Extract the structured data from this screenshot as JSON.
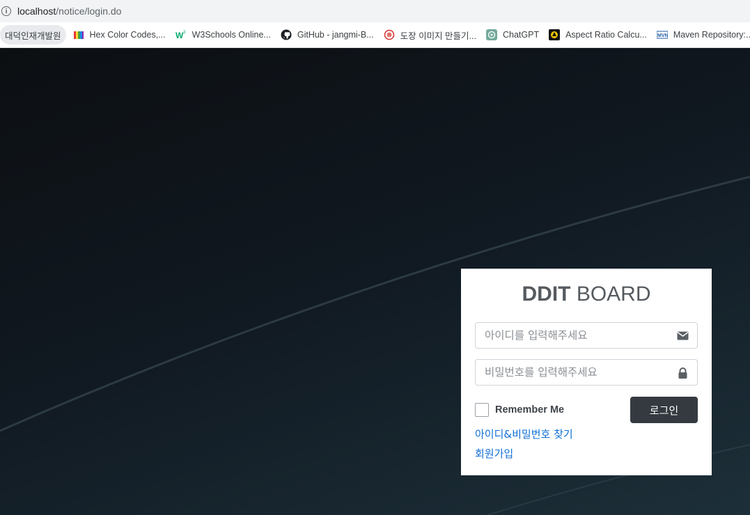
{
  "browser": {
    "url_host": "localhost",
    "url_path": "/notice/login.do",
    "bookmarks": [
      {
        "label": "대덕인재개발원",
        "icon": "folder-icon"
      },
      {
        "label": "Hex Color Codes,...",
        "icon": "color-palette-icon"
      },
      {
        "label": "W3Schools Online...",
        "icon": "w3schools-icon"
      },
      {
        "label": "GitHub - jangmi-B...",
        "icon": "github-icon"
      },
      {
        "label": "도장 이미지 만들기...",
        "icon": "stamp-icon"
      },
      {
        "label": "ChatGPT",
        "icon": "chatgpt-icon"
      },
      {
        "label": "Aspect Ratio Calcu...",
        "icon": "aspect-ratio-icon"
      },
      {
        "label": "Maven Repository:...",
        "icon": "maven-icon"
      }
    ]
  },
  "login": {
    "title_bold": "DDIT",
    "title_rest": " BOARD",
    "id_placeholder": "아이디를 입력해주세요",
    "id_value": "",
    "pw_placeholder": "비밀번호를 입력해주세요",
    "pw_value": "",
    "remember_label": "Remember Me",
    "remember_checked": false,
    "login_button": "로그인",
    "find_link": "아이디&비밀번호 찾기",
    "signup_link": "회원가입"
  },
  "colors": {
    "button_bg": "#343a40",
    "link": "#0f6fd6",
    "background_dark": "#0f1418"
  }
}
